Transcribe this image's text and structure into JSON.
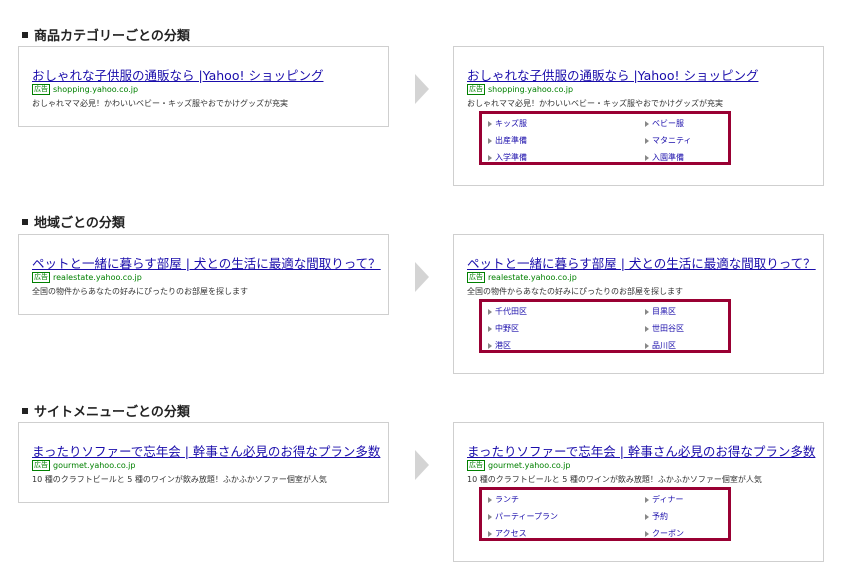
{
  "sections": [
    {
      "heading": "商品カテゴリーごとの分類",
      "ad": {
        "badge": "広告",
        "title": "おしゃれな子供服の通販なら |Yahoo! ショッピング",
        "url": "shopping.yahoo.co.jp",
        "description": "おしゃれママ必見！かわいいベビー・キッズ服やおでかけグッズが充実"
      },
      "sitelinks": [
        "キッズ服",
        "ベビー服",
        "出産準備",
        "マタニティ",
        "入学準備",
        "入園準備"
      ]
    },
    {
      "heading": "地域ごとの分類",
      "ad": {
        "badge": "広告",
        "title": "ペットと一緒に暮らす部屋 | 犬との生活に最適な間取りって？",
        "url": "realestate.yahoo.co.jp",
        "description": "全国の物件からあなたの好みにぴったりのお部屋を探します"
      },
      "sitelinks": [
        "千代田区",
        "目黒区",
        "中野区",
        "世田谷区",
        "港区",
        "品川区"
      ]
    },
    {
      "heading": "サイトメニューごとの分類",
      "ad": {
        "badge": "広告",
        "title": "まったりソファーで忘年会 | 幹事さん必見のお得なプラン多数",
        "url": "gourmet.yahoo.co.jp",
        "description": "10 種のクラフトビールと 5 種のワインが飲み放題！ふかふかソファー個室が人気"
      },
      "sitelinks": [
        "ランチ",
        "ディナー",
        "パーティープラン",
        "予約",
        "アクセス",
        "クーポン"
      ]
    }
  ],
  "colors": {
    "link": "#1a0dab",
    "url": "#008000",
    "highlight_border": "#990033",
    "arrow": "#d4d4d4"
  }
}
